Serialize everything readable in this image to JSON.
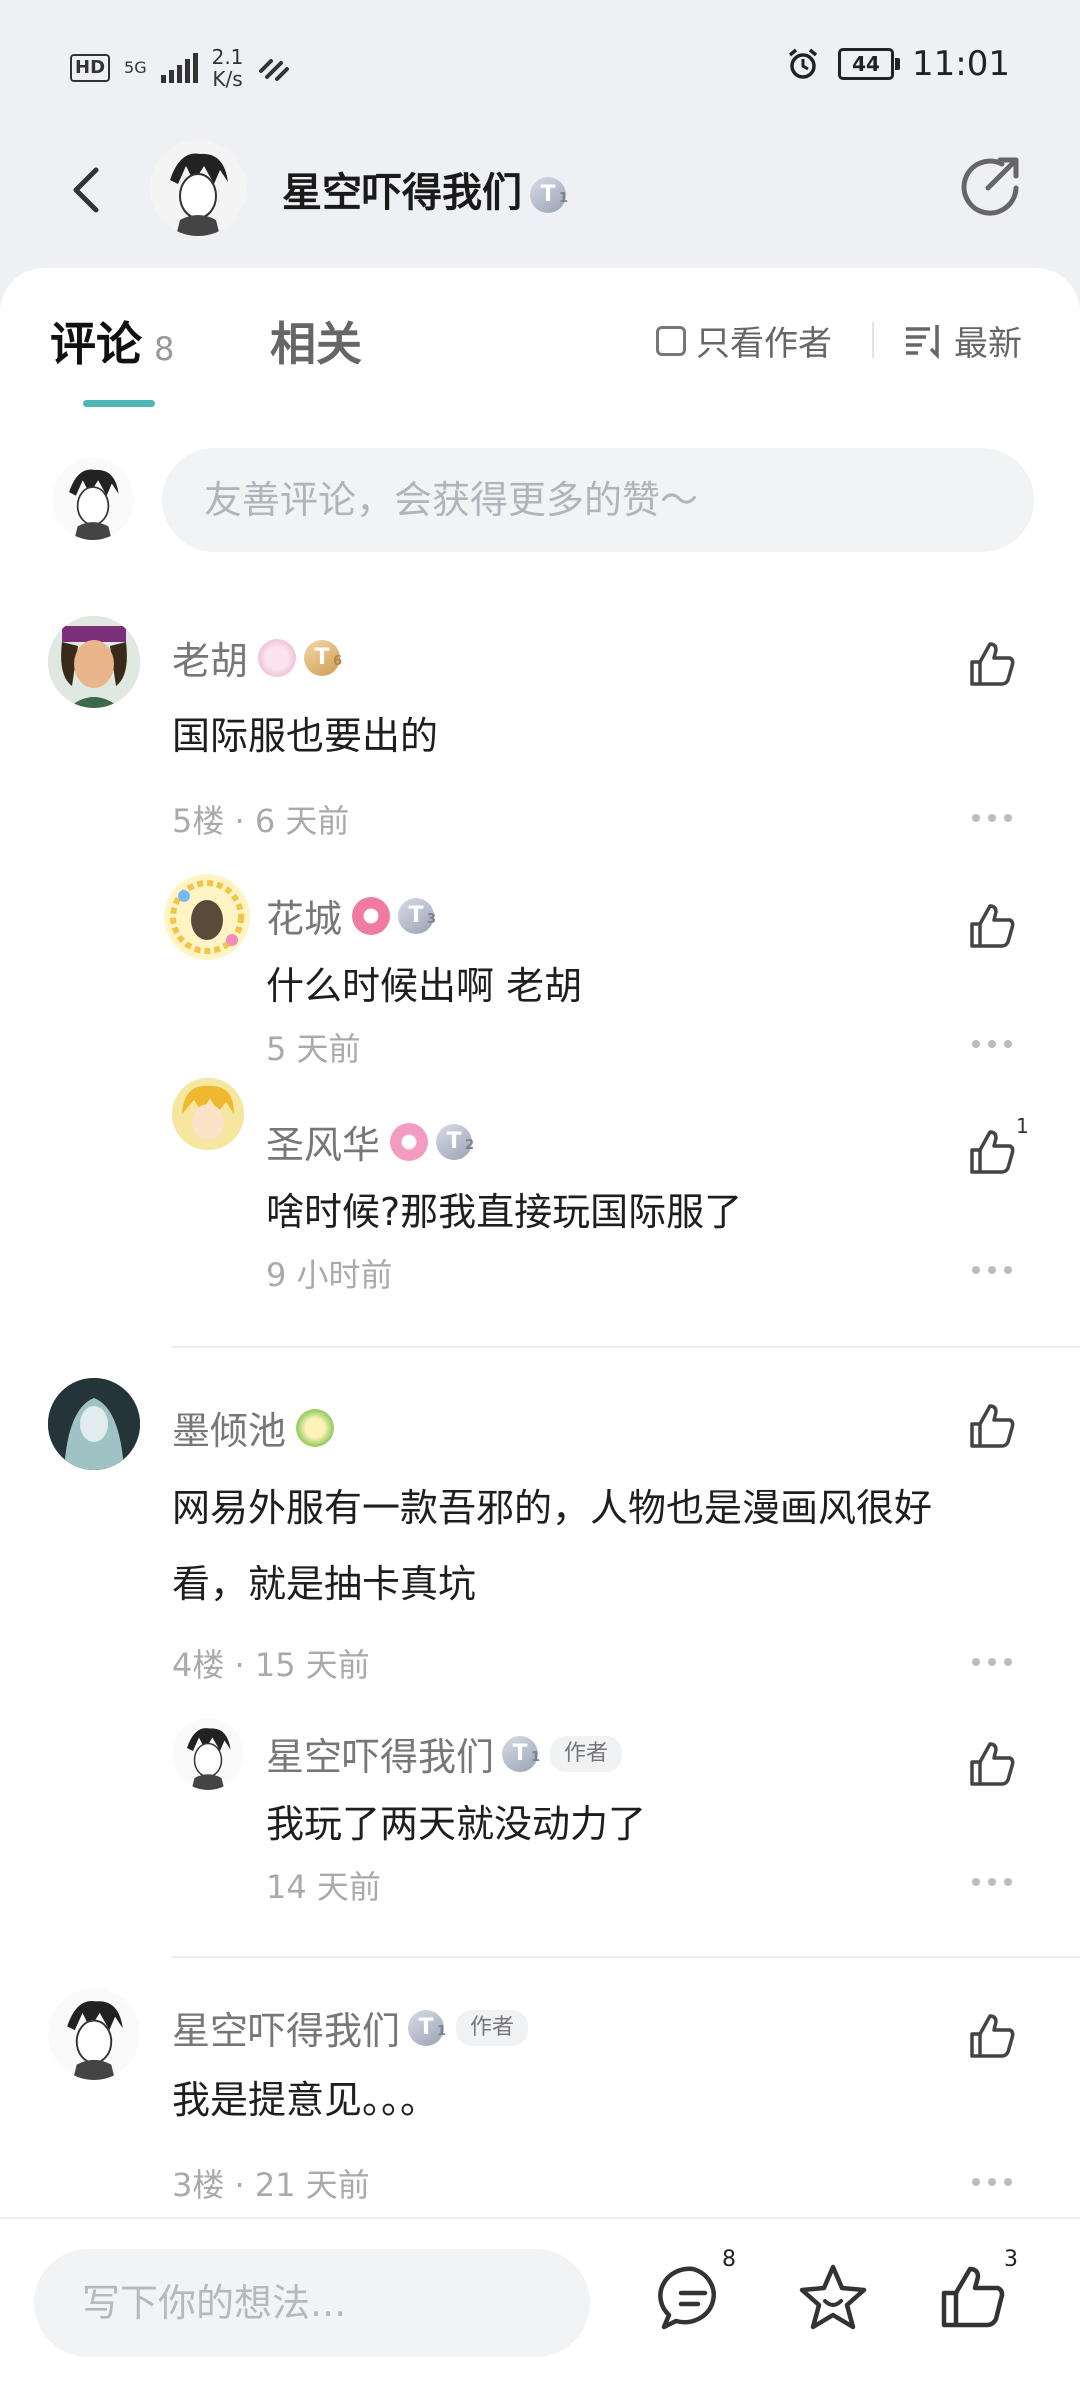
{
  "status_bar": {
    "hd": "HD",
    "network": "5G",
    "speed_value": "2.1",
    "speed_unit": "K/s",
    "battery": "44",
    "time": "11:01"
  },
  "header": {
    "title": "星空吓得我们",
    "badge_letter": "T",
    "badge_level": "1"
  },
  "tabs": {
    "comments_label": "评论",
    "comments_count": "8",
    "related_label": "相关",
    "author_only_label": "只看作者",
    "sort_label": "最新"
  },
  "composer": {
    "placeholder": "友善评论，会获得更多的赞～"
  },
  "comments": [
    {
      "name": "老胡",
      "badge_level": "6",
      "text": "国际服也要出的",
      "floor": "5楼",
      "time": "6 天前",
      "replies": [
        {
          "name": "花城",
          "badge_level": "3",
          "text": "什么时候出啊 老胡",
          "time": "5 天前"
        },
        {
          "name": "圣风华",
          "badge_level": "2",
          "text": "啥时候?那我直接玩国际服了",
          "time": "9 小时前",
          "likes": "1"
        }
      ]
    },
    {
      "name": "墨倾池",
      "text_line1": "网易外服有一款吾邪的，人物也是漫画风很好",
      "text_line2": "看，就是抽卡真坑",
      "floor": "4楼",
      "time": "15 天前",
      "replies": [
        {
          "name": "星空吓得我们",
          "badge_level": "1",
          "author_tag": "作者",
          "text": "我玩了两天就没动力了",
          "time": "14 天前"
        }
      ]
    },
    {
      "name": "星空吓得我们",
      "badge_level": "1",
      "author_tag": "作者",
      "text": "我是提意见。。。",
      "floor": "3楼",
      "time": "21 天前"
    }
  ],
  "separator": "·",
  "bottom_bar": {
    "placeholder": "写下你的想法...",
    "comment_count": "8",
    "like_count": "3"
  },
  "colors": {
    "accent": "#4fb6b8",
    "background": "#eef0f3"
  }
}
